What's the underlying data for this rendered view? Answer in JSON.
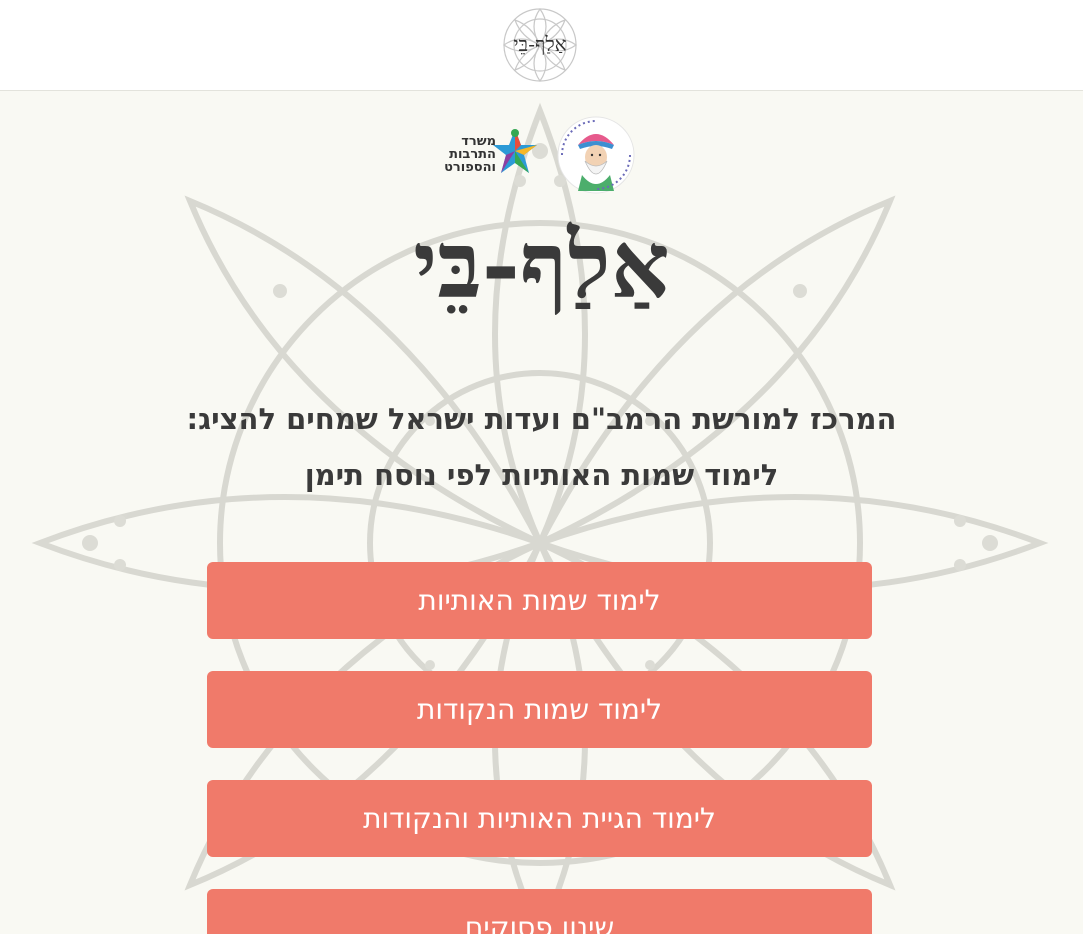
{
  "header": {
    "logo_text": "אַלַף-בֵּי"
  },
  "sponsors": {
    "ministry_label": "משרד התרבות והספורט",
    "ministry_lines": [
      "משרד",
      "התרבות",
      "והספורט"
    ],
    "rambam_label": "המרכז למורשת הרמב\"ם ועדות ישראל"
  },
  "hero": {
    "title": "אַלַף-בֵּי"
  },
  "intro": {
    "line1": "המרכז למורשת הרמב\"ם ועדות ישראל שמחים להציג:",
    "line2": "לימוד שמות האותיות לפי נוסח תימן"
  },
  "menu": {
    "buttons": [
      {
        "label": "לימוד שמות האותיות"
      },
      {
        "label": "לימוד שמות הנקודות"
      },
      {
        "label": "לימוד הגיית האותיות והנקודות"
      },
      {
        "label": "שינון פסוקים"
      }
    ]
  },
  "colors": {
    "button_bg": "#f07a6a",
    "button_text": "#ffffff",
    "page_bg": "#f9f9f3",
    "header_bg": "#ffffff",
    "text": "#3a3a3a"
  }
}
